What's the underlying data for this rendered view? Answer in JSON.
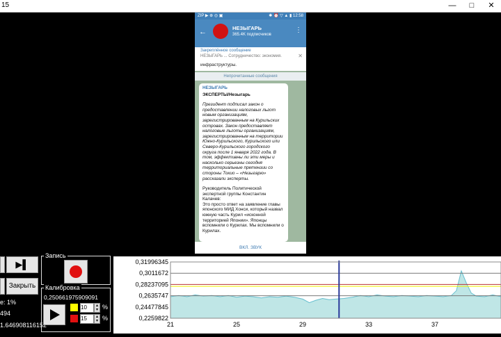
{
  "window": {
    "title": "15",
    "minimize": "—",
    "maximize": "□",
    "close": "✕"
  },
  "phone": {
    "status_left": "ZIP ▶ ⊕ ◎ ▣",
    "status_right": "✱ ⏰ ▽ ▲ ▮ 12:58",
    "channel_name": "НЕЗЫГАРЬ",
    "subscribers": "365.4K подписчиков",
    "pinned_title": "Закреплённое сообщение",
    "pinned_text": "НЕЗЫГАРЬ ... Сотрудничество: экономия.",
    "pinned_footer": "инфраструктуры.",
    "unread": "Непрочитанные сообщения",
    "msg_author": "НЕЗЫГАРЬ",
    "msg_heading": "ЭКСПЕРТЫ/Незыгарь",
    "msg_italic": "Президент подписал закон о предоставлении налоговых льгот новым организациям, зарегистрированным на Курильских островах. Закон предоставляет налоговые льготы организациям, зарегистрированным на территории Южно-Курильского, Курильского или Северо-Курильского городского округа после 1 января 2022 года. В том, эффективны ли эти меры и насколько серьезны сегодня территориальные претензии со стороны Токио – «Незыгарю» рассказали эксперты.",
    "msg_p2": "Руководитель Политической экспертной группы Константин Калачев:",
    "msg_p3": "Это просто ответ на заявление главы японского МИД Хонси, который назвал южную часть Курил «исконной территорией Японии». Японцы вспомнили о Курилах. Мы вспомнили о Курилах.",
    "bottom": "ВКЛ. ЗВУК"
  },
  "controls": {
    "play_end": "▶▌",
    "close_label": "Закрыть",
    "percent_label": "е: 1%",
    "value_494": "494",
    "value_long": "1.646908116152",
    "record_label": "Запись",
    "calibration_label": "Калибровка",
    "calibration_value": "0,250661975909091",
    "yellow_value": "10",
    "red_value": "15",
    "percent_sign": "%",
    "colors": {
      "yellow": "#ffff00",
      "red": "#e11010",
      "record": "#e11010"
    }
  },
  "chart_data": {
    "type": "area",
    "yticks": [
      "0,31996345",
      "0,3011672",
      "0,28237095",
      "0,2635747",
      "0,24477845",
      "0,2259822"
    ],
    "xticks": [
      "21",
      "25",
      "29",
      "33",
      "37"
    ],
    "ylim": [
      0.2259822,
      0.31996345
    ],
    "xlim": [
      21,
      41
    ],
    "hlines": [
      {
        "value": 0.3011672,
        "color": "#777777"
      },
      {
        "value": 0.28237095,
        "color": "#bb3333"
      },
      {
        "value": 0.2792,
        "color": "#f0f000"
      },
      {
        "value": 0.2635747,
        "color": "#777777"
      }
    ],
    "vline_x": 31.2,
    "fill_color": "#bfe6e6",
    "line_color": "#66bfcf",
    "x": [
      21,
      21.5,
      22,
      22.5,
      23,
      23.5,
      24,
      24.5,
      25,
      25.5,
      26,
      26.5,
      27,
      27.5,
      28,
      28.5,
      29,
      29.4,
      29.8,
      30.2,
      30.6,
      31,
      31.5,
      32,
      32.5,
      33,
      33.5,
      34,
      34.5,
      35,
      35.5,
      36,
      36.5,
      37,
      37.5,
      38,
      38.3,
      38.6,
      38.9,
      39.2,
      39.5,
      40,
      40.5,
      41
    ],
    "y": [
      0.262,
      0.264,
      0.262,
      0.265,
      0.263,
      0.264,
      0.262,
      0.264,
      0.261,
      0.263,
      0.262,
      0.26,
      0.262,
      0.261,
      0.263,
      0.261,
      0.258,
      0.252,
      0.256,
      0.259,
      0.257,
      0.258,
      0.259,
      0.261,
      0.264,
      0.262,
      0.265,
      0.263,
      0.262,
      0.264,
      0.263,
      0.262,
      0.264,
      0.263,
      0.262,
      0.264,
      0.272,
      0.305,
      0.285,
      0.268,
      0.263,
      0.262,
      0.265,
      0.262
    ]
  }
}
